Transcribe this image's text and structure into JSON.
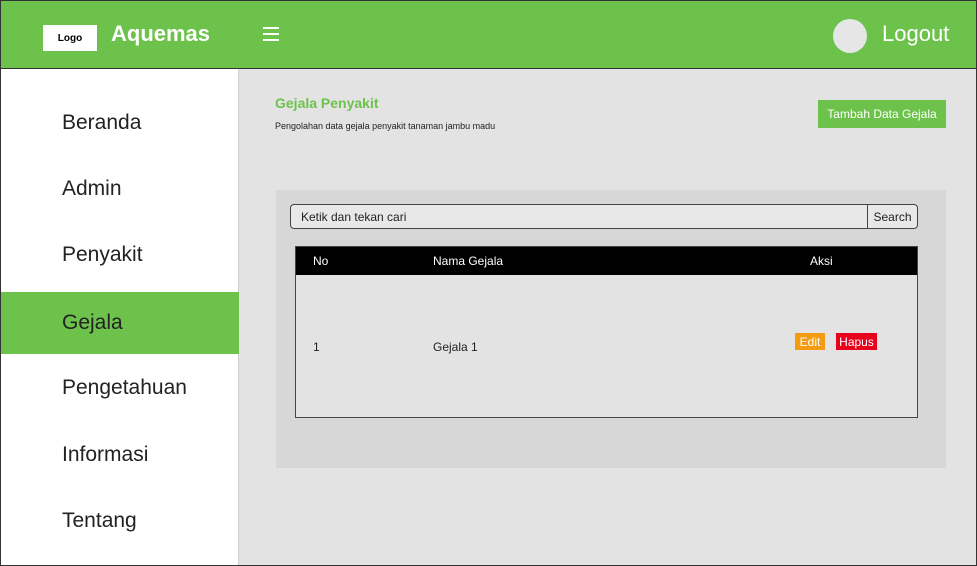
{
  "header": {
    "logo_text": "Logo",
    "app_name": "Aquemas",
    "logout_label": "Logout",
    "brand_color": "#6cc24a"
  },
  "sidebar": {
    "items": [
      {
        "label": "Beranda"
      },
      {
        "label": "Admin"
      },
      {
        "label": "Penyakit"
      },
      {
        "label": "Gejala",
        "active": true
      },
      {
        "label": "Pengetahuan"
      },
      {
        "label": "Informasi"
      },
      {
        "label": "Tentang"
      }
    ]
  },
  "main": {
    "title": "Gejala Penyakit",
    "subtitle": "Pengolahan data gejala penyakit tanaman jambu madu",
    "add_button": "Tambah Data Gejala",
    "search": {
      "value": "Ketik dan tekan cari",
      "button": "Search"
    },
    "table": {
      "headers": [
        "No",
        "Nama Gejala",
        "Aksi"
      ],
      "rows": [
        {
          "no": "1",
          "name": "Gejala 1",
          "edit": "Edit",
          "delete": "Hapus"
        }
      ]
    }
  },
  "icons": {
    "menu": "hamburger-menu-icon",
    "avatar": "user-avatar"
  },
  "colors": {
    "edit": "#f39c12",
    "delete": "#e8001c",
    "table_header": "#000000"
  }
}
